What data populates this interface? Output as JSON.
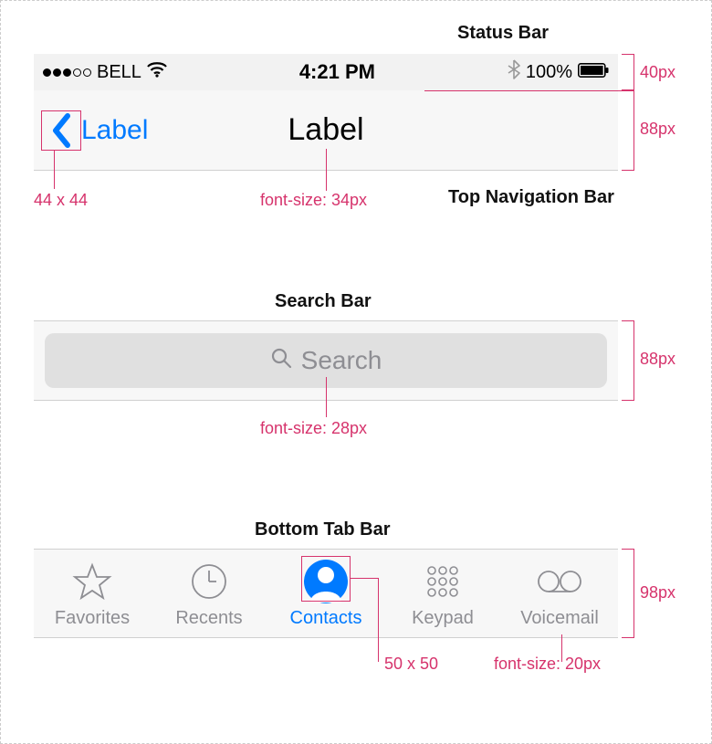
{
  "labels": {
    "statusBar": "Status Bar",
    "topNav": "Top Navigation Bar",
    "searchBar": "Search Bar",
    "bottomTab": "Bottom Tab Bar"
  },
  "status": {
    "carrier": "BELL",
    "time": "4:21 PM",
    "battery": "100%"
  },
  "nav": {
    "back": "Label",
    "title": "Label"
  },
  "search": {
    "placeholder": "Search"
  },
  "tabs": {
    "favorites": "Favorites",
    "recents": "Recents",
    "contacts": "Contacts",
    "keypad": "Keypad",
    "voicemail": "Voicemail"
  },
  "annotations": {
    "statusH": "40px",
    "navH": "88px",
    "backSize": "44 x 44",
    "titleFont": "font-size: 34px",
    "searchH": "88px",
    "searchFont": "font-size: 28px",
    "tabH": "98px",
    "tabIcon": "50 x 50",
    "tabFont": "font-size: 20px"
  }
}
